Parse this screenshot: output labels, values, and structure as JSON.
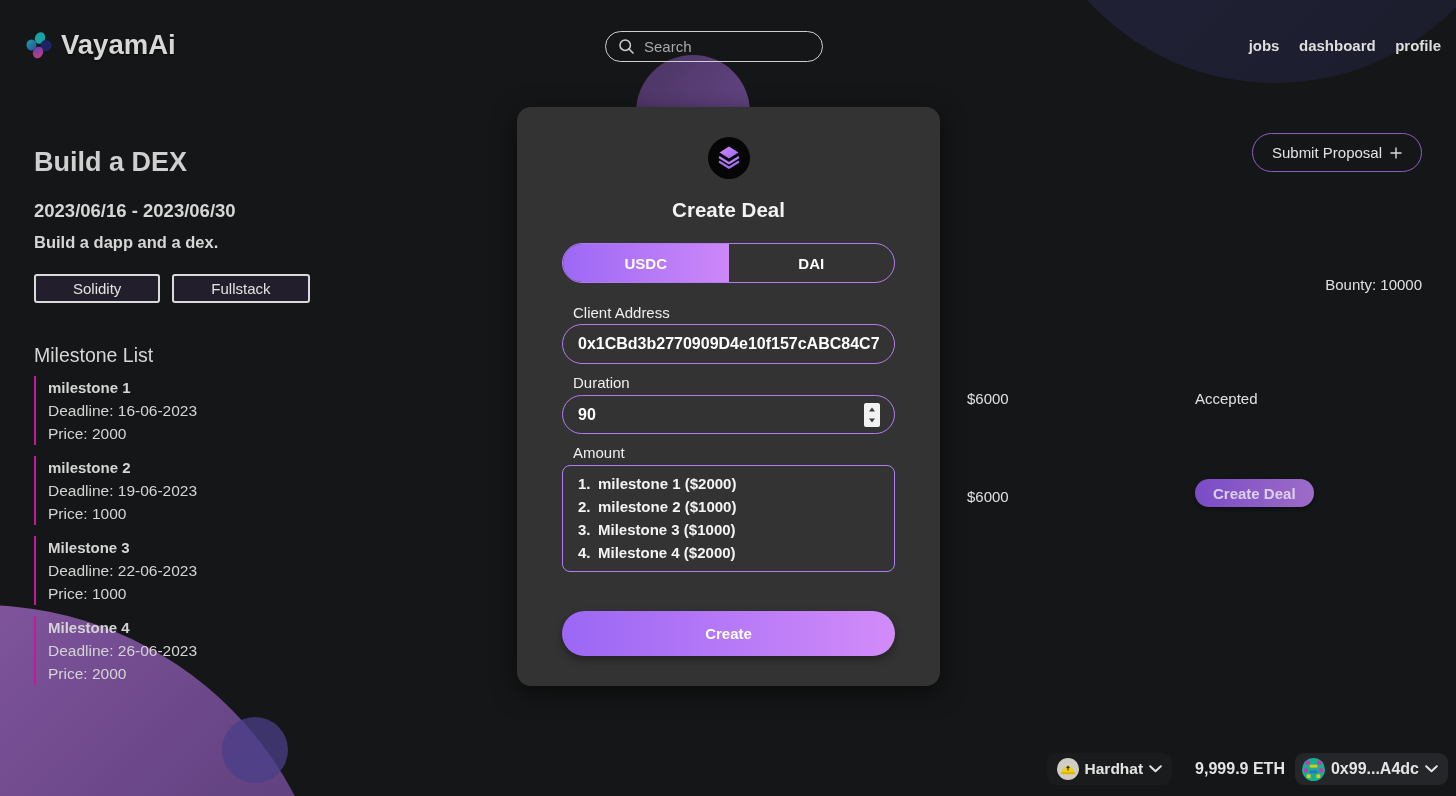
{
  "header": {
    "logo": "VayamAi",
    "search": {
      "placeholder": "Search"
    },
    "nav": [
      "jobs",
      "dashboard",
      "profile"
    ]
  },
  "job": {
    "title": "Build a DEX",
    "dates": "2023/06/16 - 2023/06/30",
    "description": "Build a dapp and a dex.",
    "tags": [
      "Solidity",
      "Fullstack"
    ],
    "milestones_heading": "Milestone List",
    "milestones": [
      {
        "name": "milestone 1",
        "deadline": "Deadline: 16-06-2023",
        "price": "Price: 2000"
      },
      {
        "name": "milestone 2",
        "deadline": "Deadline: 19-06-2023",
        "price": "Price: 1000"
      },
      {
        "name": "Milestone 3",
        "deadline": "Deadline: 22-06-2023",
        "price": "Price: 1000"
      },
      {
        "name": "Milestone 4",
        "deadline": "Deadline: 26-06-2023",
        "price": "Price: 2000"
      }
    ]
  },
  "proposals": {
    "submit_button": "Submit Proposal",
    "bounty": "Bounty: 10000",
    "rows": [
      {
        "column_1": "$6000",
        "column_2": {
          "kind": "text",
          "label": "Accepted"
        }
      },
      {
        "column_1": "$6000",
        "column_2": {
          "kind": "button",
          "label": "Create Deal"
        }
      }
    ]
  },
  "modal": {
    "title": "Create Deal",
    "currencies": [
      {
        "label": "USDC",
        "selected": true
      },
      {
        "label": "DAI",
        "selected": false
      }
    ],
    "client_address": {
      "label": "Client Address",
      "value": "0x1CBd3b2770909D4e10f157cABC84C7"
    },
    "duration": {
      "label": "Duration",
      "value": "90"
    },
    "amount": {
      "label": "Amount",
      "items": [
        {
          "number": "1.",
          "label": "milestone 1 ($2000)"
        },
        {
          "number": "2.",
          "label": "milestone 2 ($1000)"
        },
        {
          "number": "3.",
          "label": "Milestone 3 ($1000)"
        },
        {
          "number": "4.",
          "label": "Milestone 4 ($2000)"
        }
      ]
    },
    "submit": "Create"
  },
  "wallet": {
    "network": "Hardhat",
    "balance": "9,999.9 ETH",
    "account": "0x99...A4dc"
  }
}
